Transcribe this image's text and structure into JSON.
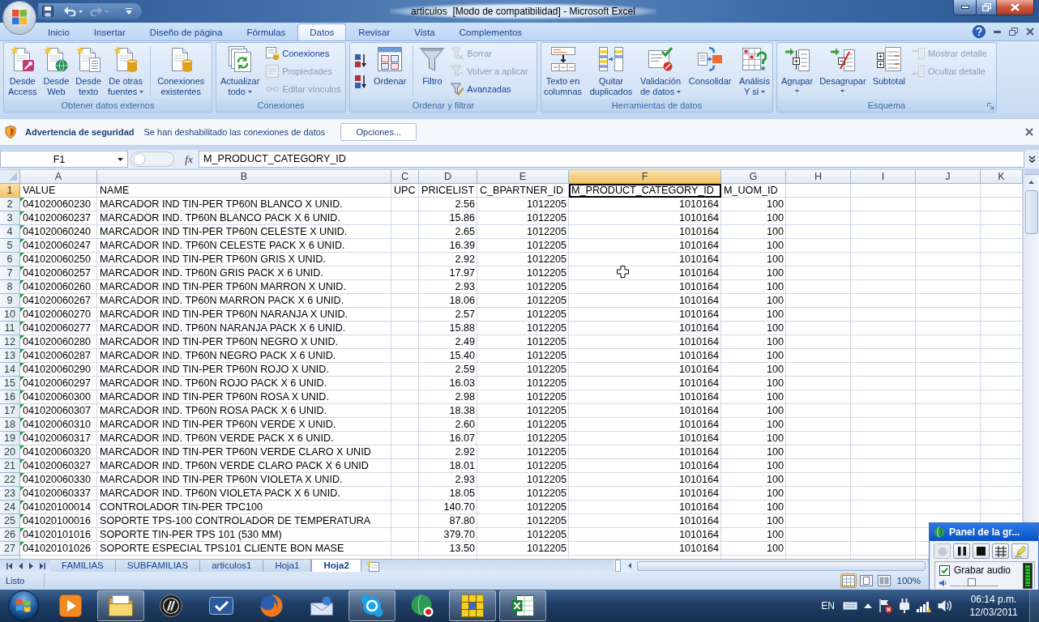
{
  "window": {
    "title": "articulos  [Modo de compatibilidad] - Microsoft Excel"
  },
  "quick_access": [
    {
      "kind": "save",
      "disabled": false
    },
    {
      "kind": "undo",
      "disabled": false
    },
    {
      "kind": "redo",
      "disabled": true
    },
    {
      "kind": "customize",
      "disabled": false
    }
  ],
  "ribbon_tabs": [
    {
      "label": "Inicio",
      "selected": false
    },
    {
      "label": "Insertar",
      "selected": false
    },
    {
      "label": "Diseño de página",
      "selected": false
    },
    {
      "label": "Fórmulas",
      "selected": false
    },
    {
      "label": "Datos",
      "selected": true
    },
    {
      "label": "Revisar",
      "selected": false
    },
    {
      "label": "Vista",
      "selected": false
    },
    {
      "label": "Complementos",
      "selected": false
    }
  ],
  "ribbon_groups": [
    {
      "label": "Obtener datos externos",
      "dialog_launcher": false,
      "items": [
        {
          "kind": "large",
          "lines": [
            "Desde",
            "Access"
          ],
          "dropdown": false
        },
        {
          "kind": "large",
          "lines": [
            "Desde",
            "Web"
          ],
          "dropdown": false
        },
        {
          "kind": "large",
          "lines": [
            "Desde",
            "texto"
          ],
          "dropdown": false
        },
        {
          "kind": "large",
          "lines": [
            "De otras",
            "fuentes"
          ],
          "dropdown": true
        },
        {
          "kind": "separator"
        },
        {
          "kind": "large",
          "lines": [
            "Conexiones",
            "existentes"
          ],
          "dropdown": false
        }
      ]
    },
    {
      "label": "Conexiones",
      "dialog_launcher": false,
      "items": [
        {
          "kind": "large",
          "lines": [
            "Actualizar",
            "todo"
          ],
          "dropdown": true
        },
        {
          "kind": "stack",
          "buttons": [
            {
              "label": "Conexiones",
              "disabled": false
            },
            {
              "label": "Propiedades",
              "disabled": true
            },
            {
              "label": "Editar vínculos",
              "disabled": true
            }
          ]
        }
      ]
    },
    {
      "label": "Ordenar y filtrar",
      "dialog_launcher": false,
      "items": [
        {
          "kind": "stack",
          "buttons": [
            {
              "disabled": false
            },
            {
              "disabled": false
            }
          ]
        },
        {
          "kind": "large",
          "lines": [
            "Ordenar"
          ],
          "dropdown": false
        },
        {
          "kind": "separator"
        },
        {
          "kind": "large",
          "lines": [
            "Filtro"
          ],
          "dropdown": false
        },
        {
          "kind": "stack",
          "buttons": [
            {
              "label": "Borrar",
              "disabled": true
            },
            {
              "label": "Volver a aplicar",
              "disabled": true
            },
            {
              "label": "Avanzadas",
              "disabled": false
            }
          ]
        }
      ]
    },
    {
      "label": "Herramientas de datos",
      "dialog_launcher": false,
      "items": [
        {
          "kind": "large",
          "lines": [
            "Texto en",
            "columnas"
          ],
          "dropdown": false
        },
        {
          "kind": "large",
          "lines": [
            "Quitar",
            "duplicados"
          ],
          "dropdown": false
        },
        {
          "kind": "large",
          "lines": [
            "Validación",
            "de datos"
          ],
          "dropdown": true
        },
        {
          "kind": "large",
          "lines": [
            "Consolidar"
          ],
          "dropdown": false
        },
        {
          "kind": "large",
          "lines": [
            "Análisis",
            "Y si"
          ],
          "dropdown": true
        }
      ]
    },
    {
      "label": "Esquema",
      "dialog_launcher": true,
      "items": [
        {
          "kind": "large",
          "lines": [
            "Agrupar"
          ],
          "dropdown": true
        },
        {
          "kind": "large",
          "lines": [
            "Desagrupar"
          ],
          "dropdown": true
        },
        {
          "kind": "large",
          "lines": [
            "Subtotal"
          ],
          "dropdown": false
        },
        {
          "kind": "stack",
          "buttons": [
            {
              "label": "Mostrar detalle",
              "disabled": true
            },
            {
              "label": "Ocultar detalle",
              "disabled": true
            }
          ]
        }
      ]
    }
  ],
  "security_bar": {
    "title": "Advertencia de seguridad",
    "message": "Se han deshabilitado las conexiones de datos",
    "button": "Opciones..."
  },
  "formula_bar": {
    "name_box": "F1",
    "function_button": "fx",
    "formula": "M_PRODUCT_CATEGORY_ID"
  },
  "sheet": {
    "columns": [
      {
        "letter": "A",
        "selected": false
      },
      {
        "letter": "B",
        "selected": false
      },
      {
        "letter": "C",
        "selected": false
      },
      {
        "letter": "D",
        "selected": false
      },
      {
        "letter": "E",
        "selected": false
      },
      {
        "letter": "F",
        "selected": true
      },
      {
        "letter": "G",
        "selected": false
      },
      {
        "letter": "H",
        "selected": false
      },
      {
        "letter": "I",
        "selected": false
      },
      {
        "letter": "J",
        "selected": false
      },
      {
        "letter": "K",
        "selected": false
      }
    ],
    "header_row": {
      "number": "1",
      "selected": true,
      "value": "VALUE",
      "name": "NAME",
      "upc": "UPC",
      "pricelist": "PRICELIST",
      "c_bpartner_id": "C_BPARTNER_ID",
      "m_product_category_id": "M_PRODUCT_CATEGORY_ID",
      "m_uom_id": "M_UOM_ID"
    },
    "rows": [
      {
        "number": "2",
        "selected": false,
        "error_mark": true,
        "value": "041020060230",
        "name": "MARCADOR IND TIN-PER TP60N BLANCO X UNID.",
        "pricelist": "2.56",
        "c_bpartner_id": "1012205",
        "m_product_category_id": "1010164",
        "m_uom_id": "100"
      },
      {
        "number": "3",
        "selected": false,
        "error_mark": true,
        "value": "041020060237",
        "name": "MARCADOR IND. TP60N BLANCO PACK X 6 UNID.",
        "pricelist": "15.86",
        "c_bpartner_id": "1012205",
        "m_product_category_id": "1010164",
        "m_uom_id": "100"
      },
      {
        "number": "4",
        "selected": false,
        "error_mark": true,
        "value": "041020060240",
        "name": "MARCADOR IND TIN-PER TP60N CELESTE X UNID.",
        "pricelist": "2.65",
        "c_bpartner_id": "1012205",
        "m_product_category_id": "1010164",
        "m_uom_id": "100"
      },
      {
        "number": "5",
        "selected": false,
        "error_mark": true,
        "value": "041020060247",
        "name": "MARCADOR IND. TP60N CELESTE PACK X 6 UNID.",
        "pricelist": "16.39",
        "c_bpartner_id": "1012205",
        "m_product_category_id": "1010164",
        "m_uom_id": "100"
      },
      {
        "number": "6",
        "selected": false,
        "error_mark": true,
        "value": "041020060250",
        "name": "MARCADOR IND TIN-PER TP60N GRIS X UNID.",
        "pricelist": "2.92",
        "c_bpartner_id": "1012205",
        "m_product_category_id": "1010164",
        "m_uom_id": "100"
      },
      {
        "number": "7",
        "selected": false,
        "error_mark": true,
        "value": "041020060257",
        "name": "MARCADOR IND. TP60N GRIS PACK X 6 UNID.",
        "pricelist": "17.97",
        "c_bpartner_id": "1012205",
        "m_product_category_id": "1010164",
        "m_uom_id": "100"
      },
      {
        "number": "8",
        "selected": false,
        "error_mark": true,
        "value": "041020060260",
        "name": "MARCADOR IND TIN-PER TP60N MARRON X UNID.",
        "pricelist": "2.93",
        "c_bpartner_id": "1012205",
        "m_product_category_id": "1010164",
        "m_uom_id": "100"
      },
      {
        "number": "9",
        "selected": false,
        "error_mark": true,
        "value": "041020060267",
        "name": "MARCADOR IND. TP60N MARRON PACK X 6 UNID.",
        "pricelist": "18.06",
        "c_bpartner_id": "1012205",
        "m_product_category_id": "1010164",
        "m_uom_id": "100"
      },
      {
        "number": "10",
        "selected": false,
        "error_mark": true,
        "value": "041020060270",
        "name": "MARCADOR IND TIN-PER TP60N NARANJA X UNID.",
        "pricelist": "2.57",
        "c_bpartner_id": "1012205",
        "m_product_category_id": "1010164",
        "m_uom_id": "100"
      },
      {
        "number": "11",
        "selected": false,
        "error_mark": true,
        "value": "041020060277",
        "name": "MARCADOR IND. TP60N NARANJA PACK X 6 UNID.",
        "pricelist": "15.88",
        "c_bpartner_id": "1012205",
        "m_product_category_id": "1010164",
        "m_uom_id": "100"
      },
      {
        "number": "12",
        "selected": false,
        "error_mark": true,
        "value": "041020060280",
        "name": "MARCADOR IND TIN-PER TP60N NEGRO X UNID.",
        "pricelist": "2.49",
        "c_bpartner_id": "1012205",
        "m_product_category_id": "1010164",
        "m_uom_id": "100"
      },
      {
        "number": "13",
        "selected": false,
        "error_mark": true,
        "value": "041020060287",
        "name": "MARCADOR IND. TP60N NEGRO PACK X 6 UNID.",
        "pricelist": "15.40",
        "c_bpartner_id": "1012205",
        "m_product_category_id": "1010164",
        "m_uom_id": "100"
      },
      {
        "number": "14",
        "selected": false,
        "error_mark": true,
        "value": "041020060290",
        "name": "MARCADOR IND TIN-PER TP60N ROJO X UNID.",
        "pricelist": "2.59",
        "c_bpartner_id": "1012205",
        "m_product_category_id": "1010164",
        "m_uom_id": "100"
      },
      {
        "number": "15",
        "selected": false,
        "error_mark": true,
        "value": "041020060297",
        "name": "MARCADOR IND. TP60N ROJO PACK X 6 UNID.",
        "pricelist": "16.03",
        "c_bpartner_id": "1012205",
        "m_product_category_id": "1010164",
        "m_uom_id": "100"
      },
      {
        "number": "16",
        "selected": false,
        "error_mark": true,
        "value": "041020060300",
        "name": "MARCADOR IND TIN-PER TP60N ROSA X UNID.",
        "pricelist": "2.98",
        "c_bpartner_id": "1012205",
        "m_product_category_id": "1010164",
        "m_uom_id": "100"
      },
      {
        "number": "17",
        "selected": false,
        "error_mark": true,
        "value": "041020060307",
        "name": "MARCADOR IND. TP60N ROSA PACK X 6 UNID.",
        "pricelist": "18.38",
        "c_bpartner_id": "1012205",
        "m_product_category_id": "1010164",
        "m_uom_id": "100"
      },
      {
        "number": "18",
        "selected": false,
        "error_mark": true,
        "value": "041020060310",
        "name": "MARCADOR IND TIN-PER TP60N VERDE X UNID.",
        "pricelist": "2.60",
        "c_bpartner_id": "1012205",
        "m_product_category_id": "1010164",
        "m_uom_id": "100"
      },
      {
        "number": "19",
        "selected": false,
        "error_mark": true,
        "value": "041020060317",
        "name": "MARCADOR IND. TP60N VERDE PACK X 6 UNID.",
        "pricelist": "16.07",
        "c_bpartner_id": "1012205",
        "m_product_category_id": "1010164",
        "m_uom_id": "100"
      },
      {
        "number": "20",
        "selected": false,
        "error_mark": true,
        "value": "041020060320",
        "name": "MARCADOR IND TIN-PER TP60N VERDE CLARO X UNID",
        "pricelist": "2.92",
        "c_bpartner_id": "1012205",
        "m_product_category_id": "1010164",
        "m_uom_id": "100"
      },
      {
        "number": "21",
        "selected": false,
        "error_mark": true,
        "value": "041020060327",
        "name": "MARCADOR IND. TP60N VERDE CLARO PACK X 6 UNID",
        "pricelist": "18.01",
        "c_bpartner_id": "1012205",
        "m_product_category_id": "1010164",
        "m_uom_id": "100"
      },
      {
        "number": "22",
        "selected": false,
        "error_mark": true,
        "value": "041020060330",
        "name": "MARCADOR IND TIN-PER TP60N VIOLETA X UNID.",
        "pricelist": "2.93",
        "c_bpartner_id": "1012205",
        "m_product_category_id": "1010164",
        "m_uom_id": "100"
      },
      {
        "number": "23",
        "selected": false,
        "error_mark": true,
        "value": "041020060337",
        "name": "MARCADOR IND. TP60N VIOLETA PACK X 6 UNID.",
        "pricelist": "18.05",
        "c_bpartner_id": "1012205",
        "m_product_category_id": "1010164",
        "m_uom_id": "100"
      },
      {
        "number": "24",
        "selected": false,
        "error_mark": true,
        "value": "041020100014",
        "name": "CONTROLADOR TIN-PER TPC100",
        "pricelist": "140.70",
        "c_bpartner_id": "1012205",
        "m_product_category_id": "1010164",
        "m_uom_id": "100"
      },
      {
        "number": "25",
        "selected": false,
        "error_mark": true,
        "value": "041020100016",
        "name": "SOPORTE TPS-100 CONTROLADOR DE TEMPERATURA",
        "pricelist": "87.80",
        "c_bpartner_id": "1012205",
        "m_product_category_id": "1010164",
        "m_uom_id": "100"
      },
      {
        "number": "26",
        "selected": false,
        "error_mark": true,
        "value": "041020101016",
        "name": "SOPORTE TIN-PER TPS 101 (530 MM)",
        "pricelist": "379.70",
        "c_bpartner_id": "1012205",
        "m_product_category_id": "1010164",
        "m_uom_id": "100"
      },
      {
        "number": "27",
        "selected": false,
        "error_mark": true,
        "value": "041020101026",
        "name": "SOPORTE ESPECIAL TPS101 CLIENTE BON MASE",
        "pricelist": "13.50",
        "c_bpartner_id": "1012205",
        "m_product_category_id": "1010164",
        "m_uom_id": "100"
      }
    ]
  },
  "sheet_tabs": [
    {
      "label": "FAMILIAS",
      "selected": false
    },
    {
      "label": "SUBFAMILIAS",
      "selected": false
    },
    {
      "label": "articulos1",
      "selected": false
    },
    {
      "label": "Hoja1",
      "selected": false
    },
    {
      "label": "Hoja2",
      "selected": true
    }
  ],
  "status_bar": {
    "status": "Listo",
    "views": [
      {
        "selected": true
      },
      {
        "selected": false
      },
      {
        "selected": false
      }
    ],
    "zoom": "100%"
  },
  "recording_panel": {
    "title": "Panel de la gr...",
    "buttons": [
      {
        "disabled": true
      },
      {
        "disabled": false
      },
      {
        "disabled": false
      },
      {
        "disabled": false
      },
      {
        "disabled": false
      }
    ],
    "audio": {
      "label": "Grabar audio",
      "checked": true
    },
    "meter": {
      "level": 1
    },
    "volume": {
      "level": 0.45
    }
  },
  "taskbar": {
    "items": [
      {
        "running": false
      },
      {
        "running": true
      },
      {
        "running": false
      },
      {
        "running": false
      },
      {
        "running": false
      },
      {
        "running": false
      },
      {
        "running": true
      },
      {
        "running": false
      },
      {
        "running": true
      },
      {
        "running": true
      }
    ],
    "language": "EN",
    "clock": {
      "time": "06:14 p.m.",
      "date": "12/03/2011"
    }
  }
}
